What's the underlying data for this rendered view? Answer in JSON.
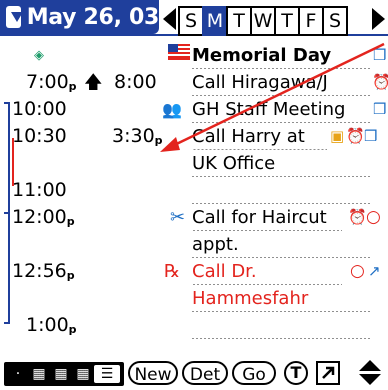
{
  "header": {
    "date": "May 26, 03",
    "days": [
      "S",
      "M",
      "T",
      "W",
      "T",
      "F",
      "S"
    ],
    "selected_day_index": 1
  },
  "rows": [
    {
      "start": "",
      "end": "",
      "desc": "Memorial Day",
      "bold": true
    },
    {
      "start": "7:00",
      "start_suffix": "p",
      "end": "8:00",
      "desc": "Call Hiragawa/J"
    },
    {
      "start": "10:00",
      "end": "",
      "desc": "GH Staff Meeting"
    },
    {
      "start": "10:30",
      "end": "3:30",
      "end_suffix": "p",
      "desc": "Call Harry at"
    },
    {
      "start": "",
      "end": "",
      "desc": "UK Office"
    },
    {
      "start": "11:00",
      "end": "",
      "desc": ""
    },
    {
      "start": "12:00",
      "start_suffix": "p",
      "end": "",
      "desc": "Call for Haircut"
    },
    {
      "start": "",
      "end": "",
      "desc": "appt."
    },
    {
      "start": "12:56",
      "start_suffix": "p",
      "end": "",
      "desc": "Call Dr.",
      "red": true
    },
    {
      "start": "",
      "end": "",
      "desc": "Hammesfahr",
      "red": true
    },
    {
      "start": "1:00",
      "start_suffix": "p",
      "end": "",
      "desc": ""
    }
  ],
  "toolbar": {
    "new_label": "New",
    "details_label": "Det",
    "go_label": "Go",
    "today_label": "T"
  },
  "colors": {
    "accent": "#1f3f9c",
    "red": "#e3241e"
  }
}
